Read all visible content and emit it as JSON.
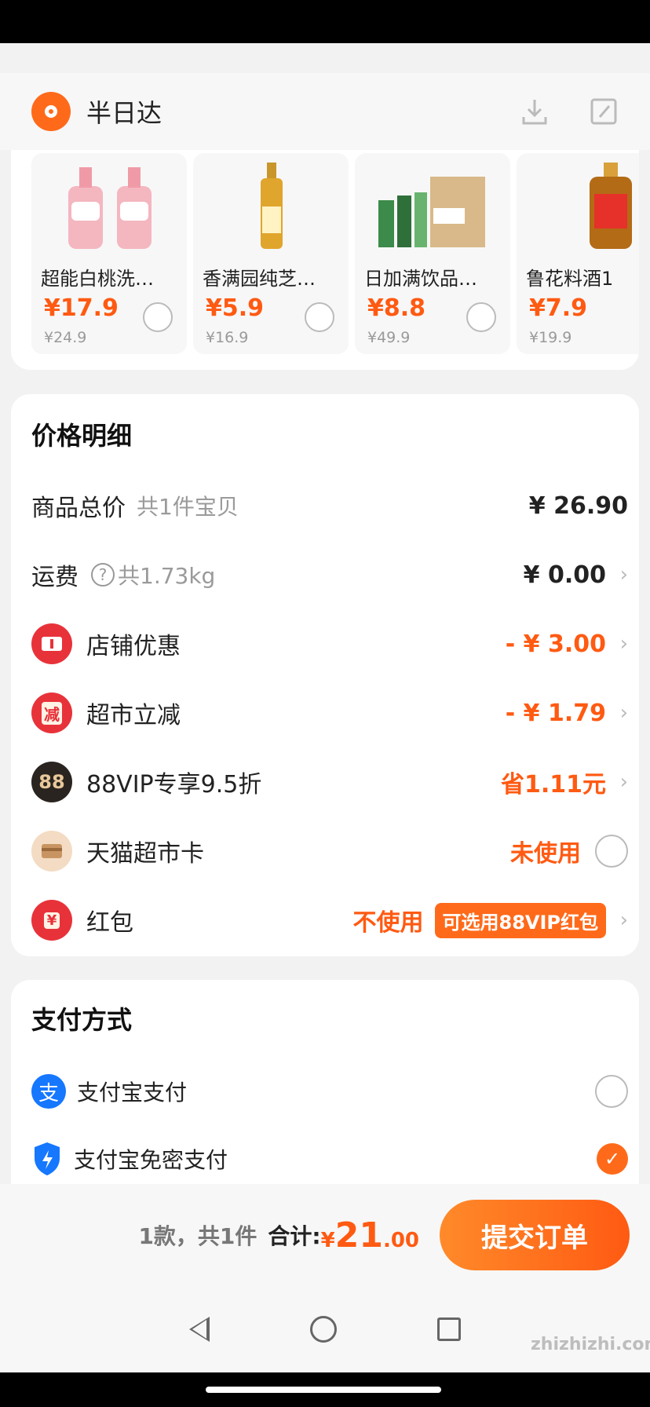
{
  "header": {
    "title": "半日达",
    "download_icon": "download-icon",
    "edit_icon": "edit-icon"
  },
  "products": [
    {
      "name": "超能白桃洗…",
      "price": "¥17.9",
      "orig": "¥24.9"
    },
    {
      "name": "香满园纯芝…",
      "price": "¥5.9",
      "orig": "¥16.9"
    },
    {
      "name": "日加满饮品…",
      "price": "¥8.8",
      "orig": "¥49.9"
    },
    {
      "name": "鲁花料酒1",
      "price": "¥7.9",
      "orig": "¥19.9"
    }
  ],
  "price_detail": {
    "title": "价格明细",
    "goods_total_label": "商品总价",
    "goods_total_sub": "共1件宝贝",
    "goods_total_value": "¥ 26.90",
    "shipping_label": "运费",
    "shipping_sub": "共1.73kg",
    "shipping_value": "¥ 0.00",
    "shop_discount_label": "店铺优惠",
    "shop_discount_value": "- ¥ 3.00",
    "market_discount_label": "超市立减",
    "market_discount_value": "- ¥ 1.79",
    "market_icon_text": "减",
    "vip_label": "88VIP专享9.5折",
    "vip_icon_text": "88",
    "vip_value": "省1.11元",
    "card_label": "天猫超市卡",
    "card_value": "未使用",
    "redpacket_label": "红包",
    "redpacket_icon_text": "¥",
    "redpacket_value": "不使用",
    "redpacket_pill": "可选用88VIP红包"
  },
  "payment": {
    "title": "支付方式",
    "alipay_label": "支付宝支付",
    "alipay_icon_text": "支",
    "alipay_nopwd_label": "支付宝免密支付"
  },
  "bottom": {
    "count_text": "1款，共1件",
    "total_label": "合计:",
    "yen": "¥",
    "total_int": "21",
    "total_dec": ".00",
    "submit_label": "提交订单"
  },
  "watermark": "zhizhizhi.com",
  "colors": {
    "accent": "#ff5a12",
    "alipay_blue": "#1677ff"
  }
}
